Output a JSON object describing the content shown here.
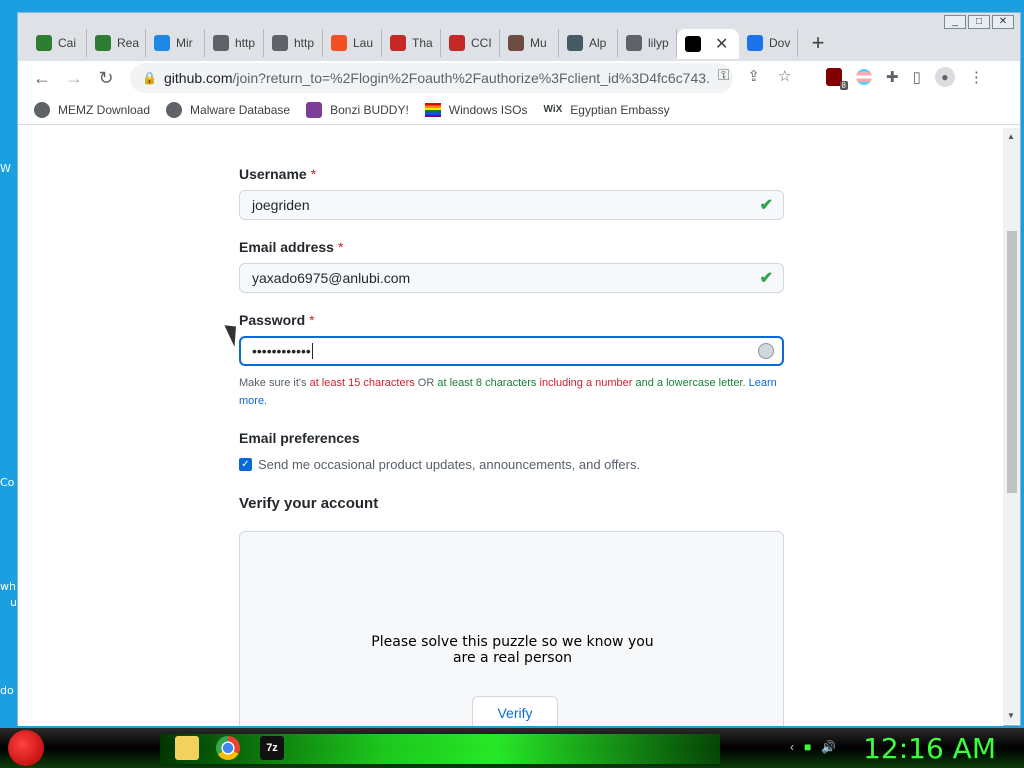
{
  "desktop": {
    "fragments": [
      "W",
      "Co",
      "wh",
      "u",
      "do"
    ]
  },
  "window": {
    "controls": [
      "_",
      "□",
      "✕"
    ]
  },
  "tabs": [
    {
      "label": "Cai",
      "favicon": "green-square-icon",
      "color": "#2e7d32"
    },
    {
      "label": "Rea",
      "favicon": "green-square-icon",
      "color": "#2e7d32"
    },
    {
      "label": "Mir",
      "favicon": "w-icon",
      "color": "#1e88e5"
    },
    {
      "label": "http",
      "favicon": "globe-icon",
      "color": "#5f6368"
    },
    {
      "label": "http",
      "favicon": "globe-icon",
      "color": "#5f6368"
    },
    {
      "label": "Lau",
      "favicon": "windows-icon",
      "color": "#f25022"
    },
    {
      "label": "Tha",
      "favicon": "tha-icon",
      "color": "#c62828"
    },
    {
      "label": "CCI",
      "favicon": "cci-icon",
      "color": "#c62828"
    },
    {
      "label": "Mu",
      "favicon": "mu-icon",
      "color": "#6d4c41"
    },
    {
      "label": "Alp",
      "favicon": "alp-icon",
      "color": "#455a64"
    },
    {
      "label": "lilyp",
      "favicon": "globe-icon",
      "color": "#5f6368"
    },
    {
      "label": "",
      "favicon": "github-icon",
      "color": "#000000",
      "active": true
    },
    {
      "label": "Dov",
      "favicon": "download-icon",
      "color": "#1a73e8"
    }
  ],
  "toolbar": {
    "url_main": "github.com",
    "url_rest": "/join?return_to=%2Flogin%2Foauth%2Fauthorize%3Fclient_id%3D4fc6c743...",
    "back": "←",
    "forward": "→",
    "reload": "↻",
    "new_tab": "+",
    "tab_menu": "⌄",
    "ublock_badge": "8"
  },
  "bookmarks": [
    {
      "label": "MEMZ Download",
      "icon": "globe-icon"
    },
    {
      "label": "Malware Database",
      "icon": "globe-icon"
    },
    {
      "label": "Bonzi BUDDY!",
      "icon": "bonzi-icon"
    },
    {
      "label": "Windows ISOs",
      "icon": "rainbow-flag-icon"
    },
    {
      "label": "Egyptian Embassy",
      "icon": "wix-icon",
      "icon_text": "WiX"
    }
  ],
  "form": {
    "username_label": "Username",
    "username_value": "joegriden",
    "email_label": "Email address",
    "email_value": "yaxado6975@anlubi.com",
    "password_label": "Password",
    "password_value": "••••••••••••",
    "required_mark": "*",
    "hint": {
      "p1": "Make sure it's ",
      "r1": "at least 15 characters",
      "p2": " OR ",
      "g1": "at least 8 characters",
      "p3": " ",
      "r2": "including a number",
      "p4": " ",
      "g2": "and a lowercase letter",
      "p5": ". ",
      "link": "Learn more."
    },
    "prefs_label": "Email preferences",
    "prefs_checkbox": "Send me occasional product updates, announcements, and offers.",
    "prefs_checked": true,
    "verify_heading": "Verify your account",
    "puzzle_line1": "Please solve this puzzle so we know you",
    "puzzle_line2": "are a real person",
    "verify_button": "Verify"
  },
  "taskbar": {
    "clock": "12:16 AM",
    "apps": [
      "explorer-icon",
      "chrome-icon",
      "7zip-icon"
    ],
    "app_7zip_text": "7z"
  }
}
